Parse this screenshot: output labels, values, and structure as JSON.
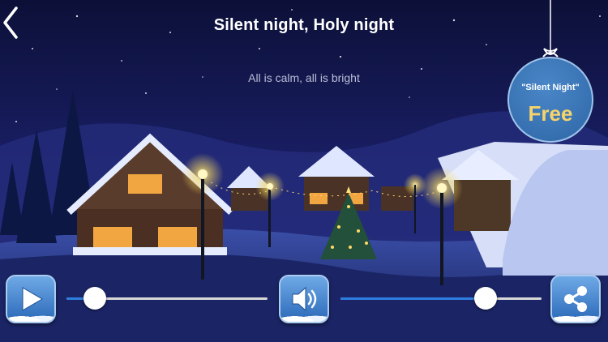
{
  "lyrics": {
    "current_line": "Silent night, Holy night",
    "next_line": "All is calm, all is bright"
  },
  "ornament_badge": {
    "song_title": "\"Silent Night\"",
    "price_label": "Free"
  },
  "controls": {
    "play_icon": "play-icon",
    "volume_icon": "speaker-icon",
    "share_icon": "share-icon",
    "progress": 0.14,
    "volume": 0.72
  },
  "colors": {
    "button_blue": "#3a7bcf",
    "slider_fill": "#2f7de0",
    "price_gold": "#f6d36b"
  }
}
